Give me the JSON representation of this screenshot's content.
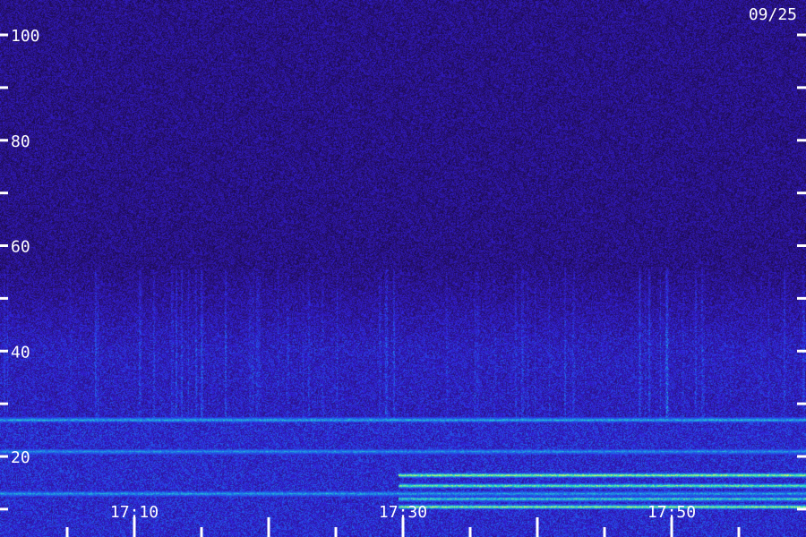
{
  "chart_data": {
    "type": "heatmap",
    "date_label": "09/25",
    "y_range": [
      10,
      100
    ],
    "y_ticks": [
      20,
      40,
      60,
      80,
      100
    ],
    "y_minor_ticks": [
      10,
      30,
      50,
      70,
      90
    ],
    "x_tick_labels": [
      "17:10",
      "17:30",
      "17:50"
    ],
    "grid": false,
    "colors": {
      "background": "#000000",
      "noise": "#2a1070",
      "low": "#2a20d8",
      "mid": "#1aa8e8",
      "high": "#ffff40",
      "text": "#ffffff"
    },
    "horizontal_bands": [
      {
        "y": 27,
        "intensity": 0.55,
        "from": "17:00",
        "to": "18:00"
      },
      {
        "y": 21,
        "intensity": 0.45,
        "from": "17:00",
        "to": "18:00"
      },
      {
        "y": 16.5,
        "intensity": 0.95,
        "from": "17:30",
        "to": "18:00"
      },
      {
        "y": 14.5,
        "intensity": 0.85,
        "from": "17:30",
        "to": "18:00"
      },
      {
        "y": 13,
        "intensity": 0.5,
        "from": "17:00",
        "to": "18:00"
      },
      {
        "y": 12,
        "intensity": 0.7,
        "from": "17:30",
        "to": "18:00"
      },
      {
        "y": 10.5,
        "intensity": 0.9,
        "from": "17:30",
        "to": "18:00"
      }
    ]
  }
}
